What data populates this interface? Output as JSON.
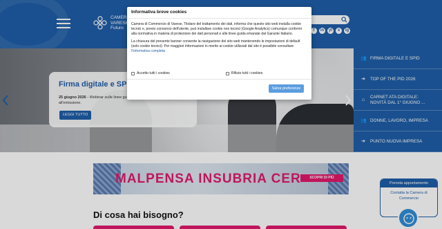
{
  "header": {
    "logo_lines": [
      "CAMERA",
      "VARESE",
      "Futuro"
    ],
    "search": {
      "placeholder": ""
    },
    "social": [
      "f",
      "in",
      "yt",
      "x",
      "ig"
    ]
  },
  "hero": {
    "title": "Firma digitale e SPID",
    "date": "25 giugno 2026",
    "text": " - Webinar sulle linee guida",
    "text2": "all'emissione.",
    "button": "LEGGI TUTTO"
  },
  "sidebar_menu": [
    {
      "icon": "users-icon",
      "glyph": "👥",
      "label": "FIRMA DIGITALE E SPID"
    },
    {
      "icon": "arrow-right-icon",
      "glyph": "➔",
      "label": "TOP OF THE PID 2026"
    },
    {
      "icon": "home-icon",
      "glyph": "⌂",
      "label": "CARNET ATA DIGITALE: NOVITÀ DAL 1° GIUGNO ..."
    },
    {
      "icon": "users-icon",
      "glyph": "👥",
      "label": "DONNE, LAVORO, IMPRESA"
    },
    {
      "icon": "arrow-right-icon",
      "glyph": "➔",
      "label": "PUNTO NUOVA IMPRESA"
    }
  ],
  "banner": {
    "title": "MALPENSA INSUBRIA CER",
    "cta": "SCOPRI DI PIÙ"
  },
  "section": {
    "title": "Di cosa hai bisogno?"
  },
  "contact": {
    "top": "Prenota appuntamento",
    "body_line1": "Contatta la Camera di",
    "body_line2": "Commercio"
  },
  "cookie_dialog": {
    "title": "Informativa breve cookies",
    "para1": "Camera di Commercio di Varese, Titolare del trattamento dei dati, informa che questo sito web installa cookie tecnici e, previo consenso dell'utente, può installare cookie non tecnici (Google Analytics) comunque conformi alla normativa in materia di protezione dei dati personali e alle linee guida emanate dal Garante Italiano.",
    "para2": "La chiusura del presente banner consente la navigazione del sito web mantenendo le impostazioni di default (solo cookie tecnici). Per maggiori informazioni in merito ai cookie utilizzati dal sito è possibile consultare",
    "link": "l'informativa completa",
    "accept_all": "Accetto tutti i cookies",
    "reject_all": "Rifiuto tutti i cookies",
    "save": "Salva preferenze"
  },
  "colors": {
    "brand": "#1f5fa8",
    "accent": "#e2196b",
    "button": "#5b9de0"
  }
}
